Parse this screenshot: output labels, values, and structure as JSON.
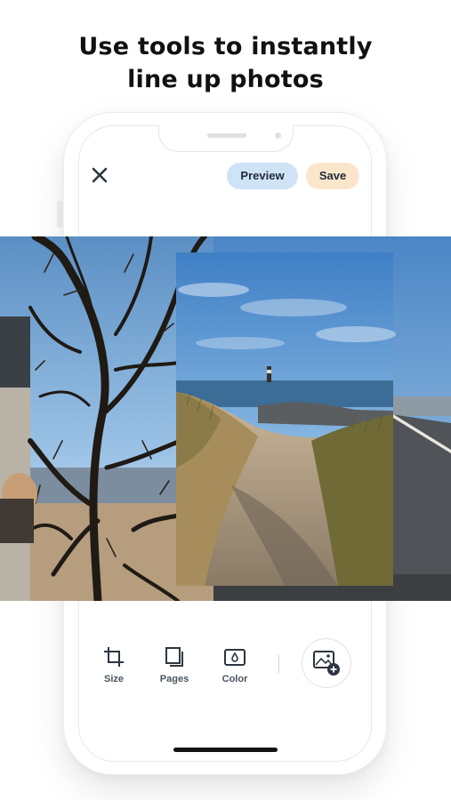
{
  "headline": {
    "line1": "Use tools to instantly",
    "line2": "line up photos"
  },
  "header": {
    "close_icon": "close-icon",
    "preview_label": "Preview",
    "save_label": "Save"
  },
  "colors": {
    "preview_bg": "#cfe3f7",
    "save_bg": "#fbe6cc",
    "text_dark": "#1f2a36",
    "label_gray": "#4a5560"
  },
  "canvas": {
    "photos": [
      "left-road-photo",
      "tree-branches-photo",
      "lighthouse-dunes-photo",
      "right-road-photo"
    ]
  },
  "toolbar": {
    "items": [
      {
        "label": "Size",
        "icon": "crop-icon"
      },
      {
        "label": "Pages",
        "icon": "pages-icon"
      },
      {
        "label": "Color",
        "icon": "color-drop-icon"
      }
    ],
    "add_photo_icon": "add-photo-icon"
  }
}
